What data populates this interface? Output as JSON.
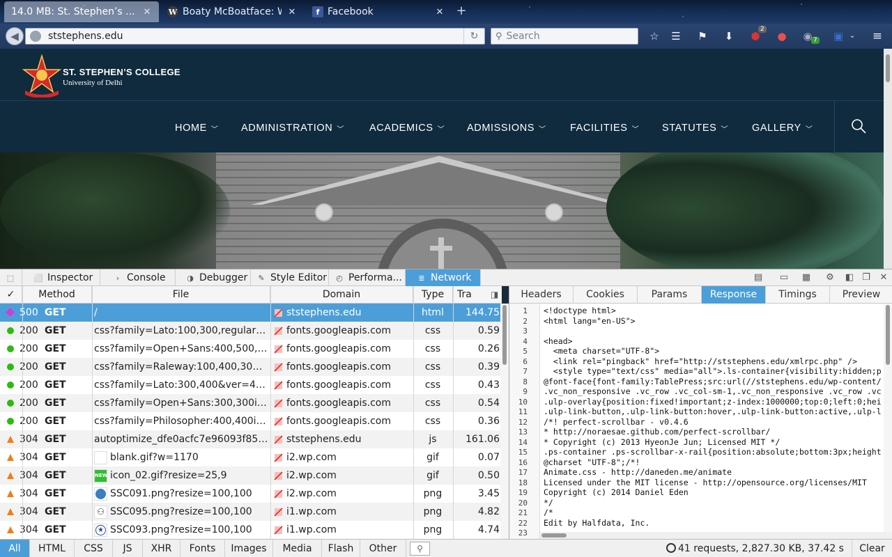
{
  "browser": {
    "tabs": [
      {
        "title": "14.0 MB: St. Stephen’s ...",
        "active": true
      },
      {
        "title": "Boaty McBoatface: W...",
        "active": false
      },
      {
        "title": "Facebook",
        "active": false
      }
    ],
    "new_tab": "+",
    "url": "ststephens.edu",
    "search_placeholder": "Search",
    "toolbar_badges": {
      "ublock_count": "2",
      "extension_count": "7"
    }
  },
  "site": {
    "name": "ST. STEPHEN’S COLLEGE",
    "subtitle": "University of Delhi",
    "nav": [
      "HOME",
      "ADMINISTRATION",
      "ACADEMICS",
      "ADMISSIONS",
      "FACILITIES",
      "STATUTES",
      "GALLERY"
    ]
  },
  "devtools": {
    "tabs": [
      {
        "label": "Inspector",
        "icon": "inspector-icon",
        "active": false
      },
      {
        "label": "Console",
        "icon": "console-icon",
        "active": false
      },
      {
        "label": "Debugger",
        "icon": "debugger-icon",
        "active": false
      },
      {
        "label": "Style Editor",
        "icon": "style-editor-icon",
        "active": false
      },
      {
        "label": "Performa...",
        "icon": "performance-icon",
        "active": false
      },
      {
        "label": "Network",
        "icon": "network-icon",
        "active": true
      }
    ],
    "columns": {
      "check": "✓",
      "method": "Method",
      "file": "File",
      "domain": "Domain",
      "type": "Type",
      "transferred": "Tra"
    },
    "requests": [
      {
        "status": "500",
        "kind": "err",
        "method": "GET",
        "file": "/",
        "domain": "ststephens.edu",
        "type": "html",
        "transferred": "144.75",
        "selected": true
      },
      {
        "status": "200",
        "kind": "ok",
        "method": "GET",
        "file": "css?family=Lato:100,300,regular,70...",
        "domain": "fonts.googleapis.com",
        "type": "css",
        "transferred": "0.59"
      },
      {
        "status": "200",
        "kind": "ok",
        "method": "GET",
        "file": "css?family=Open+Sans:400,500,60...",
        "domain": "fonts.googleapis.com",
        "type": "css",
        "transferred": "0.26"
      },
      {
        "status": "200",
        "kind": "ok",
        "method": "GET",
        "file": "css?family=Raleway:100,400,300,5...",
        "domain": "fonts.googleapis.com",
        "type": "css",
        "transferred": "0.39"
      },
      {
        "status": "200",
        "kind": "ok",
        "method": "GET",
        "file": "css?family=Lato:300,400&ver=4.4.2",
        "domain": "fonts.googleapis.com",
        "type": "css",
        "transferred": "0.43"
      },
      {
        "status": "200",
        "kind": "ok",
        "method": "GET",
        "file": "css?family=Open+Sans:300,300itali...",
        "domain": "fonts.googleapis.com",
        "type": "css",
        "transferred": "0.54"
      },
      {
        "status": "200",
        "kind": "ok",
        "method": "GET",
        "file": "css?family=Philosopher:400,400itali...",
        "domain": "fonts.googleapis.com",
        "type": "css",
        "transferred": "0.36"
      },
      {
        "status": "304",
        "kind": "warn",
        "method": "GET",
        "file": "autoptimize_dfe0acfc7e96093f85e...",
        "domain": "ststephens.edu",
        "type": "js",
        "transferred": "161.06"
      },
      {
        "status": "304",
        "kind": "warn",
        "method": "GET",
        "file": "blank.gif?w=1170",
        "domain": "i2.wp.com",
        "type": "gif",
        "transferred": "0.07",
        "thumb": "blank"
      },
      {
        "status": "304",
        "kind": "warn",
        "method": "GET",
        "file": "icon_02.gif?resize=25,9",
        "domain": "i2.wp.com",
        "type": "gif",
        "transferred": "0.50",
        "thumb": "new"
      },
      {
        "status": "304",
        "kind": "warn",
        "method": "GET",
        "file": "SSC091.png?resize=100,100",
        "domain": "i2.wp.com",
        "type": "png",
        "transferred": "3.45",
        "thumb": "globe"
      },
      {
        "status": "304",
        "kind": "warn",
        "method": "GET",
        "file": "SSC095.png?resize=100,100",
        "domain": "i1.wp.com",
        "type": "png",
        "transferred": "4.82",
        "thumb": "group"
      },
      {
        "status": "304",
        "kind": "warn",
        "method": "GET",
        "file": "SSC093.png?resize=100,100",
        "domain": "i1.wp.com",
        "type": "png",
        "transferred": "4.74",
        "thumb": "star"
      }
    ],
    "detail_tabs": [
      {
        "label": "Headers",
        "active": false
      },
      {
        "label": "Cookies",
        "active": false
      },
      {
        "label": "Params",
        "active": false
      },
      {
        "label": "Response",
        "active": true
      },
      {
        "label": "Timings",
        "active": false
      },
      {
        "label": "Preview",
        "active": false
      }
    ],
    "code_lines": [
      "<!doctype html>",
      "<html lang=\"en-US\">",
      "",
      "<head>",
      "  <meta charset=\"UTF-8\">",
      "  <link rel=\"pingback\" href=\"http://ststephens.edu/xmlrpc.php\" />",
      "  <style type=\"text/css\" media=\"all\">.ls-container{visibility:hidden;p",
      "@font-face{font-family:TablePress;src:url(//ststephens.edu/wp-content/",
      ".vc_non_responsive .vc_row .vc_col-sm-1,.vc_non_responsive .vc_row .vc",
      ".ulp-overlay{position:fixed!important;z-index:1000000;top:0;left:0;hei",
      ".ulp-link-button,.ulp-link-button:hover,.ulp-link-button:active,.ulp-l",
      "/*! perfect-scrollbar - v0.4.6",
      "* http://noraesae.github.com/perfect-scrollbar/",
      "* Copyright (c) 2013 HyeonJe Jun; Licensed MIT */",
      ".ps-container .ps-scrollbar-x-rail{position:absolute;bottom:3px;height",
      "@charset \"UTF-8\";/*!",
      "Animate.css - http://daneden.me/animate",
      "Licensed under the MIT license - http://opensource.org/licenses/MIT",
      "Copyright (c) 2014 Daniel Eden",
      "*/",
      "/*",
      "Edit by Halfdata, Inc.",
      ""
    ],
    "filters": [
      {
        "label": "All",
        "active": true
      },
      {
        "label": "HTML"
      },
      {
        "label": "CSS"
      },
      {
        "label": "JS"
      },
      {
        "label": "XHR"
      },
      {
        "label": "Fonts"
      },
      {
        "label": "Images"
      },
      {
        "label": "Media"
      },
      {
        "label": "Flash"
      },
      {
        "label": "Other"
      }
    ],
    "summary": "41 requests, 2,827.30 KB, 37.42 s",
    "clear_label": "Clear"
  },
  "colors": {
    "accent": "#4c9ed9",
    "site_header": "#0f2b3d",
    "status_ok": "#2cbb0f",
    "status_warn": "#f07e12",
    "status_err": "#d43bd4"
  }
}
